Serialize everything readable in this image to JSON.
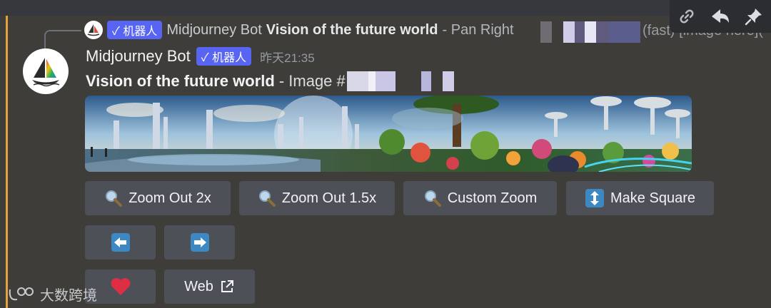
{
  "reply": {
    "author": "Midjourney Bot",
    "badge": "✓ 机器人",
    "prompt": "Vision of the future world",
    "action": "- Pan Right",
    "tail": "(fast) [image here]("
  },
  "message": {
    "author": "Midjourney Bot",
    "badge": "✓ 机器人",
    "timestamp": "昨天21:35",
    "prompt": "Vision of the future world",
    "rest": "- Image #"
  },
  "toolbar": {
    "icons": [
      "link-icon",
      "reply-icon",
      "pin-icon"
    ]
  },
  "buttons": {
    "zoom_out_2x": "Zoom Out 2x",
    "zoom_out_15x": "Zoom Out 1.5x",
    "custom_zoom": "Custom Zoom",
    "make_square": "Make Square",
    "web": "Web"
  },
  "watermark": {
    "text": "大数跨境"
  },
  "colors": {
    "accent": "#5865f2",
    "highlight_bar": "#e6a23c",
    "button_bg": "#4e5058",
    "arrow_blue": "#3b88c3",
    "heart": "#dd2e44"
  }
}
